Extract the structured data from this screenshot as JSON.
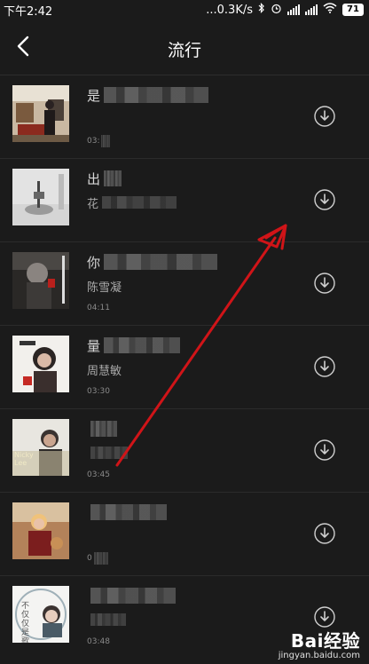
{
  "status": {
    "time": "下午2:42",
    "network_speed": "...0.3K/s",
    "battery": "71"
  },
  "header": {
    "title": "流行",
    "back_icon": "chevron-left-icon"
  },
  "songs": [
    {
      "title": "是",
      "artist": "",
      "duration": "03:"
    },
    {
      "title": "出",
      "artist": "花",
      "duration": ""
    },
    {
      "title": "你",
      "artist": "陈雪凝",
      "duration": "04:11"
    },
    {
      "title": "量",
      "artist": "周慧敏",
      "duration": "03:30"
    },
    {
      "title": "",
      "artist": "",
      "duration": "03:45",
      "cover_text": "Nicky Lee"
    },
    {
      "title": "",
      "artist": "",
      "duration": "0"
    },
    {
      "title": "",
      "artist": "",
      "duration": "03:48",
      "cover_text": "不仅仅是歌"
    }
  ],
  "watermark": {
    "logo": "Bai经验",
    "sub": "jingyan.baidu.com"
  },
  "icons": {
    "download": "download-circle-icon"
  },
  "colors": {
    "background": "#1b1b1b",
    "arrow": "#d01418"
  }
}
